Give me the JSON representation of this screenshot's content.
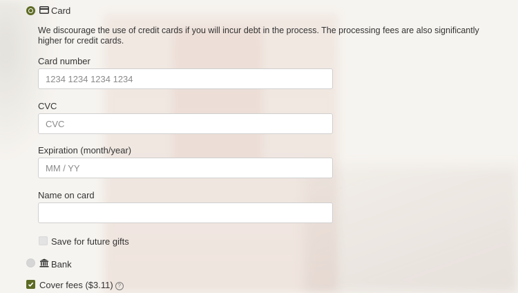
{
  "payment_methods": {
    "card": {
      "label": "Card",
      "icon": "credit-card-icon",
      "selected": true
    },
    "bank": {
      "label": "Bank",
      "icon": "bank-icon",
      "selected": false
    }
  },
  "card_notice": "We discourage the use of credit cards if you will incur debt in the process. The processing fees are also significantly higher for credit cards.",
  "fields": {
    "card_number": {
      "label": "Card number",
      "placeholder": "1234 1234 1234 1234",
      "value": ""
    },
    "cvc": {
      "label": "CVC",
      "placeholder": "CVC",
      "value": ""
    },
    "expiration": {
      "label": "Expiration (month/year)",
      "placeholder": "MM / YY",
      "value": ""
    },
    "name_on_card": {
      "label": "Name on card",
      "placeholder": "",
      "value": ""
    }
  },
  "save_for_future": {
    "label": "Save for future gifts",
    "checked": false
  },
  "cover_fees": {
    "label": "Cover fees ($3.11)",
    "checked": true,
    "help_icon": "question-circle-icon"
  },
  "colors": {
    "accent": "#5d6b24"
  }
}
